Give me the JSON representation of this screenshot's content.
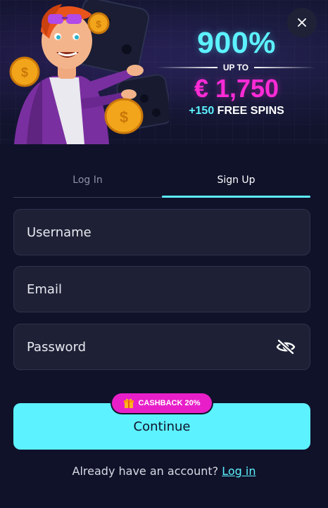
{
  "banner": {
    "percent": "900%",
    "up_to": "UP TO",
    "amount": "€ 1,750",
    "spins_highlight": "+150",
    "spins_text": " FREE SPINS",
    "close_icon": "close-icon",
    "colors": {
      "cyan": "#5cf2ff",
      "magenta": "#ff2bd6",
      "background": "#12142e"
    }
  },
  "tabs": [
    {
      "label": "Log In",
      "active": false
    },
    {
      "label": "Sign Up",
      "active": true
    }
  ],
  "form": {
    "username_placeholder": "Username",
    "email_placeholder": "Email",
    "password_placeholder": "Password",
    "password_toggle_icon": "eye-off-icon"
  },
  "cta": {
    "badge_icon": "gift-icon",
    "badge": "CASHBACK 20%",
    "continue_label": "Continue",
    "accent": "#5cf2ff"
  },
  "footer": {
    "prompt": "Already have an account?",
    "login_link": "Log in"
  }
}
